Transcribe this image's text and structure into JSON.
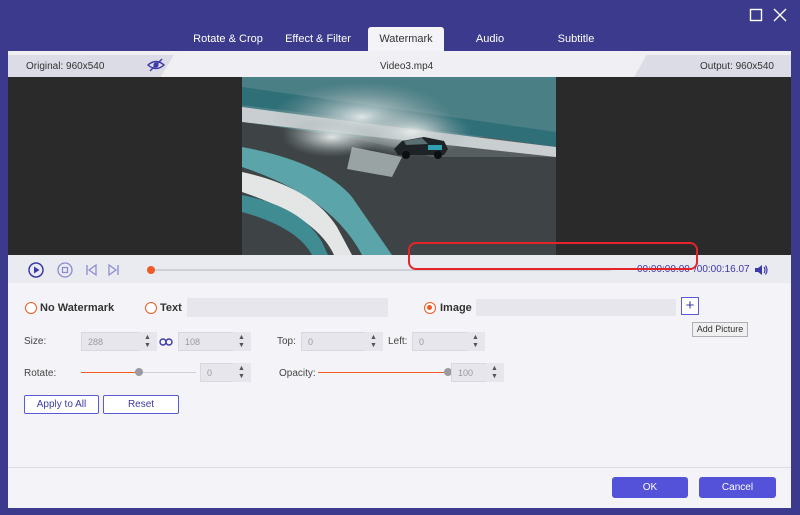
{
  "window": {
    "maximize_icon": "maximize-icon",
    "close_icon": "close-icon"
  },
  "tabs": [
    {
      "label": "Rotate & Crop",
      "active": false
    },
    {
      "label": "Effect & Filter",
      "active": false
    },
    {
      "label": "Watermark",
      "active": true
    },
    {
      "label": "Audio",
      "active": false
    },
    {
      "label": "Subtitle",
      "active": false
    }
  ],
  "info": {
    "original": "Original: 960x540",
    "filename": "Video3.mp4",
    "output": "Output: 960x540",
    "eye_icon": "eye-icon"
  },
  "player": {
    "current_time": "00:00:00.00",
    "total_time": "/00:00:16.07",
    "progress": 0
  },
  "watermark": {
    "no_watermark_label": "No Watermark",
    "text_label": "Text",
    "image_label": "Image",
    "selected": "image",
    "add_button": "+",
    "tooltip": "Add Picture"
  },
  "controls": {
    "size_label": "Size:",
    "width": "288",
    "height": "108",
    "top_label": "Top:",
    "top": "0",
    "left_label": "Left:",
    "left": "0",
    "rotate_label": "Rotate:",
    "rotate": "0",
    "rotate_level": 0.5,
    "opacity_label": "Opacity:",
    "opacity": "100",
    "opacity_level": 1.0
  },
  "buttons": {
    "apply_all": "Apply to All",
    "reset": "Reset",
    "ok": "OK",
    "cancel": "Cancel"
  },
  "colors": {
    "accent": "#5352d8",
    "orange": "#f05a24",
    "highlight": "#e3242b",
    "frame": "#3b3a8c"
  }
}
